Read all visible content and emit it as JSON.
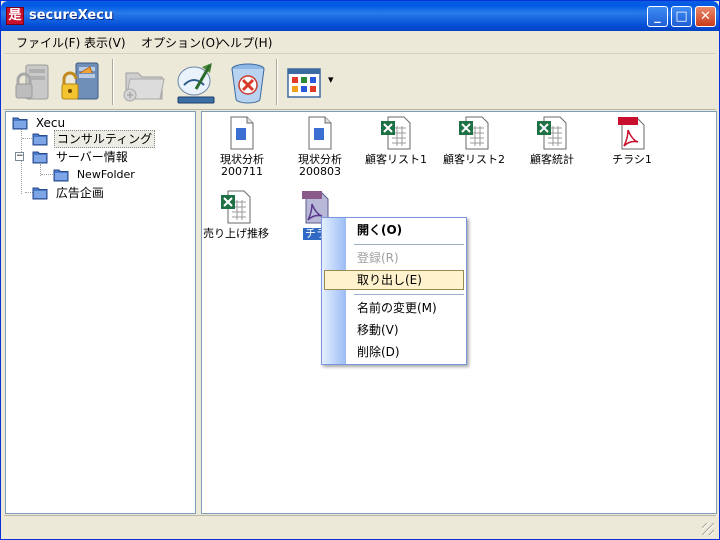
{
  "window": {
    "title": "secureXecu",
    "app_icon_char": "是"
  },
  "title_buttons": {
    "minimize": "_",
    "maximize": "□",
    "close": "✕"
  },
  "menu": [
    "ファイル(F)",
    "表示(V)",
    "オプション(O)",
    "ヘルプ(H)"
  ],
  "toolbar": {
    "icons": [
      "lock-server-icon",
      "unlock-server-icon",
      "folder-new-icon",
      "edit-view-icon",
      "recycle-bin-icon",
      "view-icons-icon"
    ],
    "dropdown": "▾"
  },
  "tree": {
    "nodes": [
      {
        "label": "Xecu"
      },
      {
        "label": "コンサルティング"
      },
      {
        "label": "サーバー情報"
      },
      {
        "label": "NewFolder"
      },
      {
        "label": "広告企画"
      }
    ],
    "expander_symbol": "−"
  },
  "files": [
    {
      "line1": "現状分析",
      "line2": "200711",
      "type": "doc"
    },
    {
      "line1": "現状分析",
      "line2": "200803",
      "type": "doc"
    },
    {
      "line1": "顧客リスト1",
      "line2": "",
      "type": "excel"
    },
    {
      "line1": "顧客リスト2",
      "line2": "",
      "type": "excel"
    },
    {
      "line1": "顧客統計",
      "line2": "",
      "type": "excel"
    },
    {
      "line1": "チラシ1",
      "line2": "",
      "type": "pdf"
    },
    {
      "line1": "売り上げ推移",
      "line2": "",
      "type": "excel"
    },
    {
      "line1": "チラ",
      "line2": "",
      "type": "pdf"
    }
  ],
  "context_menu": {
    "open": "開く(O)",
    "register": "登録(R)",
    "extract": "取り出し(E)",
    "rename": "名前の変更(M)",
    "move": "移動(V)",
    "delete": "削除(D)"
  },
  "colors": {
    "titlebar": "#0058e6",
    "selection": "#316ac5",
    "menu_hover": "#fff2cc",
    "excel_green": "#1e7145",
    "pdf_red": "#c8102e"
  }
}
